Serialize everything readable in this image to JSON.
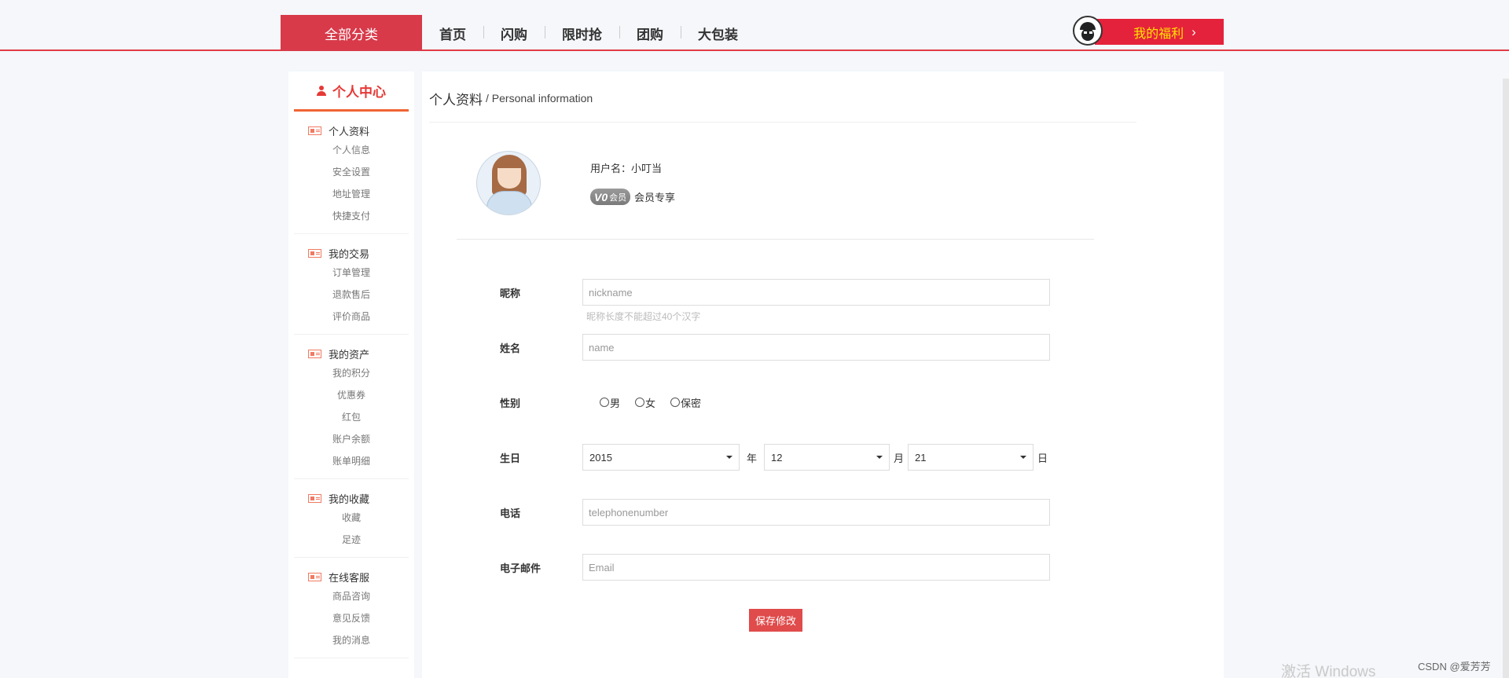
{
  "header": {
    "all_categories": "全部分类",
    "nav": [
      "首页",
      "闪购",
      "限时抢",
      "团购",
      "大包装"
    ],
    "welfare": "我的福利",
    "welfare_arrow": "›"
  },
  "sidebar": {
    "title": "个人中心",
    "groups": [
      {
        "title": "个人资料",
        "links": [
          "个人信息",
          "安全设置",
          "地址管理",
          "快捷支付"
        ]
      },
      {
        "title": "我的交易",
        "links": [
          "订单管理",
          "退款售后",
          "评价商品"
        ]
      },
      {
        "title": "我的资产",
        "links": [
          "我的积分",
          "优惠券",
          "红包",
          "账户余额",
          "账单明细"
        ]
      },
      {
        "title": "我的收藏",
        "links": [
          "收藏",
          "足迹"
        ]
      },
      {
        "title": "在线客服",
        "links": [
          "商品咨询",
          "意见反馈",
          "我的消息"
        ]
      }
    ]
  },
  "main": {
    "title": "个人资料",
    "subtitle": "/ Personal information",
    "username_label": "用户名：",
    "username": "小叮当",
    "vip_level": "V0",
    "vip_badge_text": "会员",
    "vip_text": "会员专享",
    "form": {
      "nickname_label": "昵称",
      "nickname_placeholder": "nickname",
      "nickname_hint": "昵称长度不能超过40个汉字",
      "name_label": "姓名",
      "name_placeholder": "name",
      "gender_label": "性别",
      "gender_options": [
        "男",
        "女",
        "保密"
      ],
      "birthday_label": "生日",
      "year": "2015",
      "year_unit": "年",
      "month": "12",
      "month_unit": "月",
      "day": "21",
      "day_unit": "日",
      "phone_label": "电话",
      "phone_placeholder": "telephonenumber",
      "email_label": "电子邮件",
      "email_placeholder": "Email",
      "save_label": "保存修改"
    }
  },
  "overlay": {
    "watermark": "激活 Windows",
    "csdn": "CSDN @爱芳芳"
  }
}
